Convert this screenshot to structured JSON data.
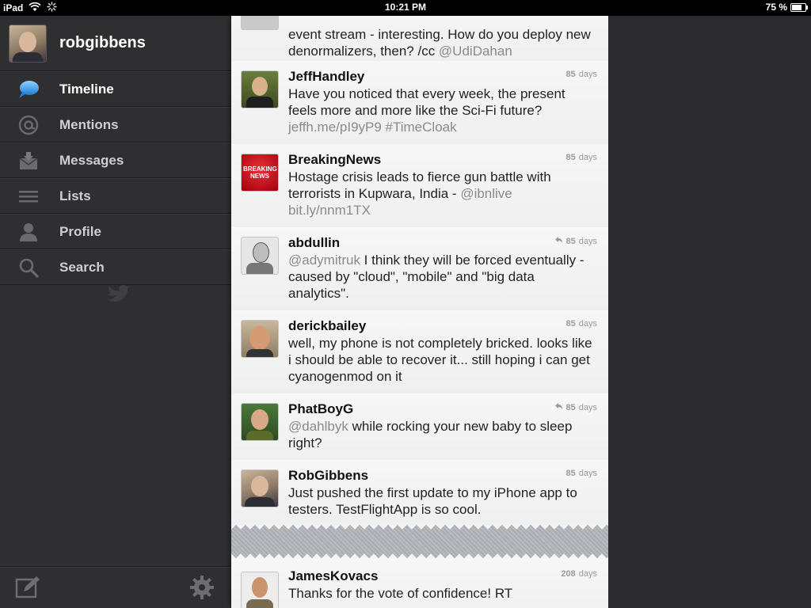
{
  "status_bar": {
    "device": "iPad",
    "time": "10:21 PM",
    "battery": "75 %",
    "battery_level": 0.75
  },
  "sidebar": {
    "username": "robgibbens",
    "items": [
      {
        "label": "Timeline",
        "icon": "speech-bubble-icon",
        "active": true
      },
      {
        "label": "Mentions",
        "icon": "at-icon"
      },
      {
        "label": "Messages",
        "icon": "envelope-icon"
      },
      {
        "label": "Lists",
        "icon": "list-icon"
      },
      {
        "label": "Profile",
        "icon": "person-icon"
      },
      {
        "label": "Search",
        "icon": "search-icon"
      }
    ],
    "footer": {
      "compose_icon": "compose-icon",
      "settings_icon": "gear-icon"
    }
  },
  "timeline": {
    "tweets": [
      {
        "user": "",
        "time": "",
        "unit": "",
        "text_parts": [
          {
            "t": "event stream - interesting. How do you deploy new denormalizers, then? /cc "
          },
          {
            "t": "@UdiDahan",
            "muted": true
          }
        ]
      },
      {
        "user": "JeffHandley",
        "time": "85",
        "unit": "days",
        "reply": false,
        "text_parts": [
          {
            "t": "Have you noticed that every week, the present feels more and more like the Sci-Fi future? "
          },
          {
            "t": "jeffh.me/pI9yP9 #TimeCloak",
            "muted": true
          }
        ]
      },
      {
        "user": "BreakingNews",
        "time": "85",
        "unit": "days",
        "reply": false,
        "avatar_text": "BREAKING NEWS",
        "text_parts": [
          {
            "t": "Hostage crisis leads to fierce gun battle with terrorists in Kupwara, India - "
          },
          {
            "t": "@ibnlive bit.ly/nnm1TX",
            "muted": true
          }
        ]
      },
      {
        "user": "abdullin",
        "time": "85",
        "unit": "days",
        "reply": true,
        "text_parts": [
          {
            "t": "@adymitruk",
            "muted": true
          },
          {
            "t": " I think they will be forced eventually - caused by \"cloud\", \"mobile\" and \"big data analytics\"."
          }
        ]
      },
      {
        "user": "derickbailey",
        "time": "85",
        "unit": "days",
        "reply": false,
        "text_parts": [
          {
            "t": "well, my phone is not completely bricked. looks like i should be able to recover it... still hoping i can get cyanogenmod on it"
          }
        ]
      },
      {
        "user": "PhatBoyG",
        "time": "85",
        "unit": "days",
        "reply": true,
        "text_parts": [
          {
            "t": "@dahlbyk",
            "muted": true
          },
          {
            "t": " while rocking your new baby to sleep right?"
          }
        ]
      },
      {
        "user": "RobGibbens",
        "time": "85",
        "unit": "days",
        "reply": false,
        "text_parts": [
          {
            "t": "Just pushed the first update to my iPhone app to testers.  TestFlightApp is so cool."
          }
        ]
      },
      {
        "user": "JamesKovacs",
        "time": "208",
        "unit": "days",
        "reply": false,
        "text_parts": [
          {
            "t": "Thanks for the vote of confidence! RT"
          }
        ]
      }
    ]
  },
  "colors": {
    "sidebar_bg": "#2f2f31",
    "timeline_bg": "#f4f4f4",
    "link": "#8a8a8a"
  }
}
